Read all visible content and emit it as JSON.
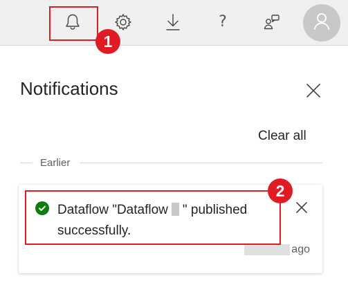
{
  "toolbar": {
    "buttons": [
      {
        "name": "notifications",
        "icon": "bell-icon"
      },
      {
        "name": "settings",
        "icon": "gear-icon"
      },
      {
        "name": "download",
        "icon": "download-icon"
      },
      {
        "name": "help",
        "icon": "question-mark-icon",
        "glyph": "?"
      },
      {
        "name": "feedback",
        "icon": "feedback-icon"
      },
      {
        "name": "account",
        "icon": "person-icon"
      }
    ]
  },
  "annotations": {
    "color": "#e01b24",
    "step1": "1",
    "step2": "2"
  },
  "panel": {
    "title": "Notifications",
    "clear_all": "Clear all",
    "section_label": "Earlier"
  },
  "notification": {
    "status_icon": "success-check-icon",
    "status_color": "#107c10",
    "message_prefix": "Dataflow \"Dataflow",
    "message_suffix": "\" published successfully.",
    "time_suffix": "ago"
  }
}
